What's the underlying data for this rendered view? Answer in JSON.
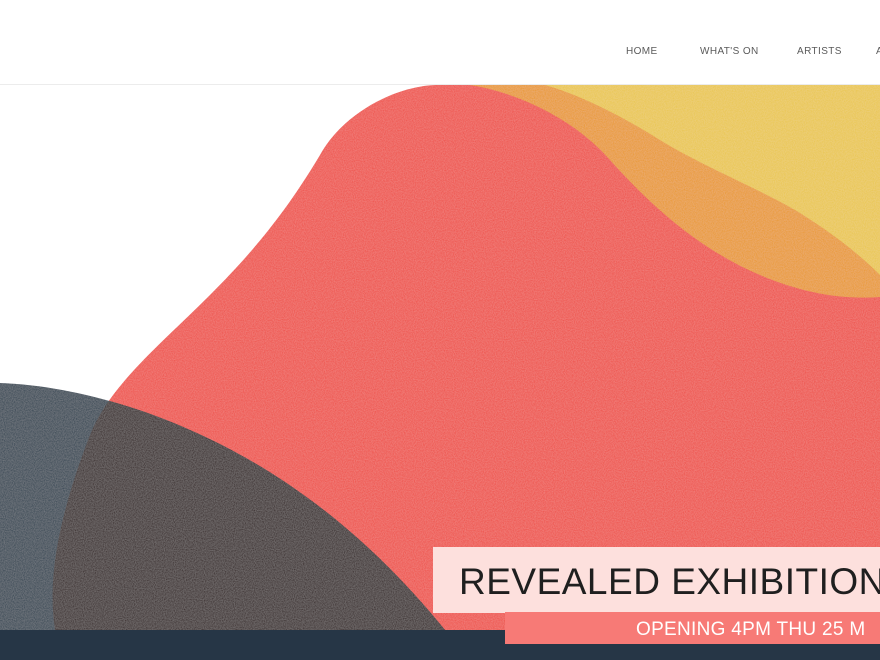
{
  "nav": {
    "items": [
      {
        "label": "HOME"
      },
      {
        "label": "WHAT'S ON"
      },
      {
        "label": "ARTISTS"
      },
      {
        "label": "A"
      }
    ]
  },
  "hero": {
    "title": "REVEALED EXHIBITION",
    "subtitle": "OPENING 4PM THU 25 M",
    "colors": {
      "red": "#ee4a40",
      "yellow": "#e9c544",
      "orange": "#e8961f",
      "navy": "#283a4c",
      "dark_overlap": "#2a1313",
      "title_bg": "#fde0dd",
      "subtitle_bg": "#f77a76",
      "bottom_bar": "#263646"
    }
  }
}
